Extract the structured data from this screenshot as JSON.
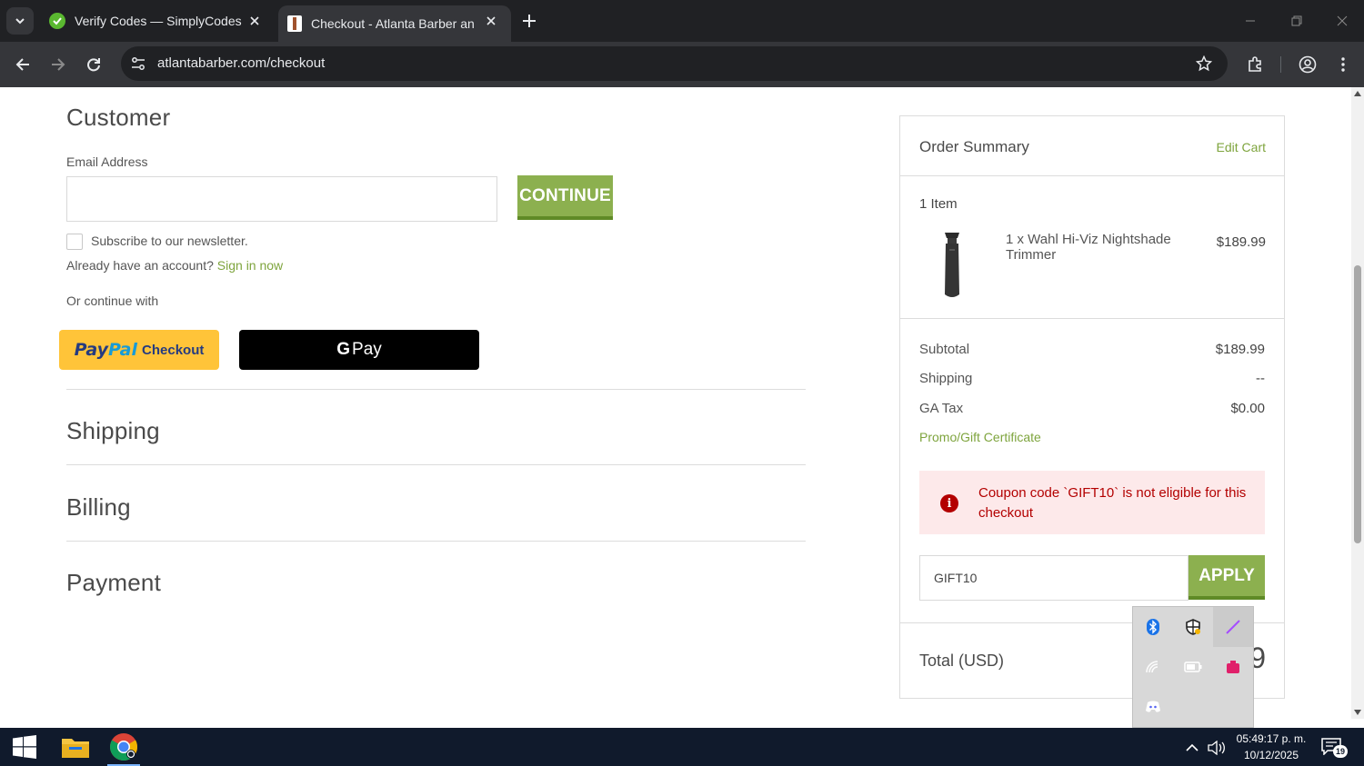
{
  "browser": {
    "tabs": [
      {
        "title": "Verify Codes — SimplyCodes",
        "active": false
      },
      {
        "title": "Checkout - Atlanta Barber and B",
        "active": true
      }
    ],
    "url": "atlantabarber.com/checkout"
  },
  "checkout": {
    "customer_heading": "Customer",
    "email_label": "Email Address",
    "email_value": "",
    "continue_label": "CONTINUE",
    "newsletter_label": "Subscribe to our newsletter.",
    "account_prompt": "Already have an account?",
    "sign_in_label": "Sign in now",
    "continue_with_label": "Or continue with",
    "paypal": {
      "pay": "Pay",
      "pal": "Pal",
      "checkout": "Checkout"
    },
    "gpay": {
      "g": "G",
      "pay": "Pay"
    },
    "shipping_heading": "Shipping",
    "billing_heading": "Billing",
    "payment_heading": "Payment"
  },
  "order_summary": {
    "title": "Order Summary",
    "edit_cart_label": "Edit Cart",
    "item_count": "1 Item",
    "item": {
      "name": "1 x Wahl Hi-Viz Nightshade Trimmer",
      "price": "$189.99"
    },
    "subtotal_label": "Subtotal",
    "subtotal_value": "$189.99",
    "shipping_label": "Shipping",
    "shipping_value": "--",
    "tax_label": "GA Tax",
    "tax_value": "$0.00",
    "promo_label": "Promo/Gift Certificate",
    "alert_message": "Coupon code `GIFT10` is not eligible for this checkout",
    "coupon_value": "GIFT10",
    "apply_label": "APPLY",
    "total_label": "Total (USD)",
    "total_value": "9"
  },
  "taskbar": {
    "time": "05:49:17 p. m.",
    "date": "10/12/2025",
    "notification_count": "19"
  },
  "colors": {
    "accent_green": "#8cb04f",
    "link_green": "#7ea43d",
    "error_red": "#b30000",
    "error_bg": "#fde9ea",
    "paypal_yellow": "#ffc439"
  }
}
